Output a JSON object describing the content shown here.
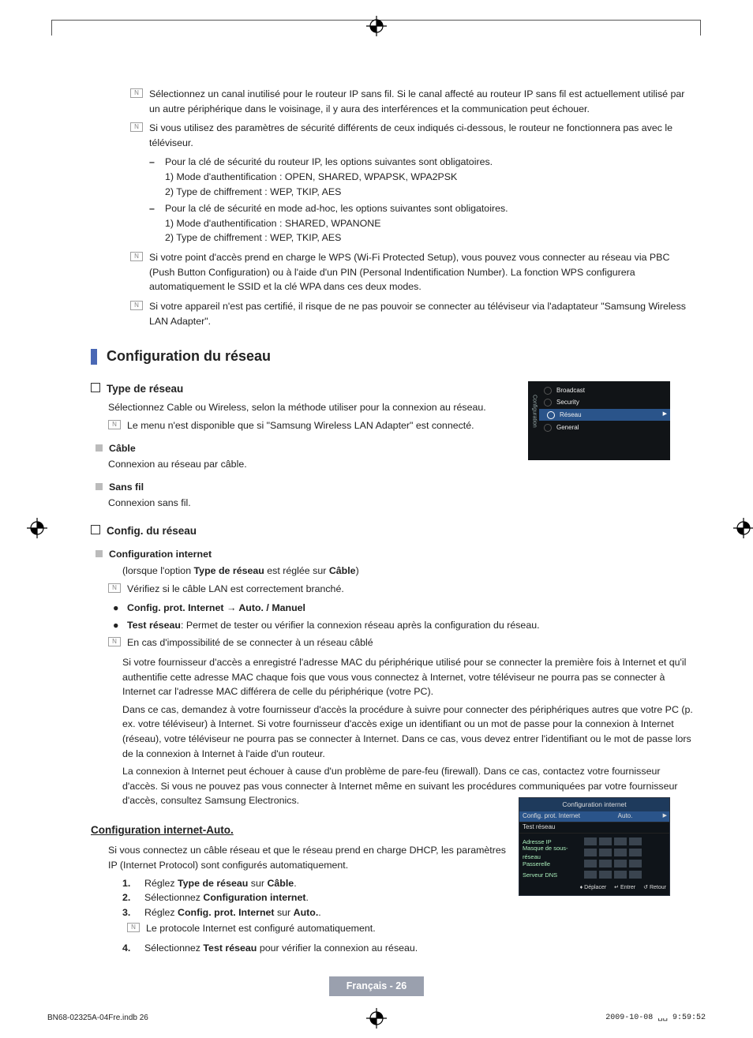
{
  "notes": {
    "n1": "Sélectionnez un canal inutilisé pour le routeur IP sans fil. Si le canal affecté au routeur IP sans fil est actuellement utilisé par un autre périphérique dans le voisinage, il y aura des interférences et la communication peut échouer.",
    "n2": "Si vous utilisez des paramètres de sécurité différents de ceux indiqués ci-dessous, le routeur ne fonctionnera pas avec le téléviseur.",
    "n2a": "Pour la clé de sécurité du routeur IP, les options suivantes sont obligatoires.",
    "n2a1": "1) Mode d'authentification : OPEN, SHARED, WPAPSK, WPA2PSK",
    "n2a2": "2) Type de chiffrement : WEP, TKIP, AES",
    "n2b": "Pour la clé de sécurité en mode ad-hoc, les options suivantes sont obligatoires.",
    "n2b1": "1) Mode d'authentification : SHARED, WPANONE",
    "n2b2": "2) Type de chiffrement : WEP, TKIP, AES",
    "n3": "Si votre point d'accès prend en charge le WPS (Wi-Fi Protected Setup), vous pouvez vous connecter au réseau via PBC (Push Button Configuration) ou à l'aide d'un PIN (Personal Indentification Number). La fonction WPS configurera automatiquement le SSID et la clé WPA dans ces deux modes.",
    "n4": "Si votre appareil n'est pas certifié, il risque de ne pas pouvoir se connecter au téléviseur via l'adaptateur \"Samsung Wireless LAN Adapter\"."
  },
  "section_title": "Configuration du réseau",
  "typeReseau": {
    "heading": "Type de réseau",
    "intro": "Sélectionnez Cable ou Wireless, selon la méthode utiliser pour la connexion au réseau.",
    "note": "Le menu n'est disponible que si \"Samsung Wireless LAN Adapter\" est connecté.",
    "cable_h": "Câble",
    "cable_b": "Connexion au réseau par câble.",
    "sans_h": "Sans fil",
    "sans_b": "Connexion sans fil."
  },
  "configReseau": {
    "heading": "Config. du réseau",
    "ci_h": "Configuration internet",
    "ci_pre": "(lorsque l'option ",
    "ci_b1": "Type de réseau",
    "ci_mid": " est réglée sur ",
    "ci_b2": "Câble",
    "ci_post": ")",
    "ci_note": "Vérifiez si le câble LAN est correctement branché.",
    "bul1_b": "Config. prot. Internet",
    "bul1_t": " → Auto. / Manuel",
    "bul2_b": "Test réseau",
    "bul2_t": ": Permet de tester ou vérifier la connexion réseau après la configuration du réseau.",
    "cannot": "En cas d'impossibilité de se connecter à un réseau câblé",
    "p1": "Si votre fournisseur d'accès a enregistré l'adresse MAC du périphérique utilisé pour se connecter la première fois à Internet et qu'il authentifie cette adresse MAC chaque fois que vous vous connectez à Internet, votre téléviseur ne pourra pas se connecter à Internet car l'adresse MAC différera de celle du périphérique (votre PC).",
    "p2": "Dans ce cas, demandez à votre fournisseur d'accès la procédure à suivre pour connecter des périphériques autres que votre PC (p. ex. votre téléviseur) à Internet. Si votre fournisseur d'accès exige un identifiant ou un mot de passe pour la connexion à Internet (réseau), votre téléviseur ne pourra pas se connecter à Internet. Dans ce cas, vous devez entrer l'identifiant ou le mot de passe lors de la connexion à Internet à l'aide d'un routeur.",
    "p3": "La connexion à Internet peut échouer à cause d'un problème de pare-feu (firewall). Dans ce cas, contactez votre fournisseur d'accès. Si vous ne pouvez pas vous connecter à Internet même en suivant les procédures communiquées par votre fournisseur d'accès, consultez Samsung Electronics."
  },
  "autoSection": {
    "title": "Configuration internet-Auto.",
    "intro": "Si vous connectez un câble réseau et que le réseau prend en charge DHCP, les paramètres IP (Internet Protocol) sont configurés automatiquement.",
    "s1_pre": "Réglez ",
    "s1_b": "Type de réseau",
    "s1_mid": " sur ",
    "s1_b2": "Câble",
    "s1_post": ".",
    "s2_pre": "Sélectionnez ",
    "s2_b": "Configuration internet",
    "s2_post": ".",
    "s3_pre": "Réglez ",
    "s3_b": "Config. prot. Internet",
    "s3_mid": " sur ",
    "s3_b2": "Auto.",
    "s3_post": ".",
    "s3_note": "Le protocole Internet est configuré automatiquement.",
    "s4_pre": "Sélectionnez ",
    "s4_b": "Test réseau",
    "s4_post": " pour vérifier la connexion au réseau."
  },
  "notebox": "N",
  "fig1": {
    "side": "Configuration",
    "r1": "Broadcast",
    "r2": "Security",
    "r3": "Réseau",
    "r4": "General"
  },
  "fig2": {
    "title": "Configuration internet",
    "row1l": "Config. prot. Internet",
    "row1v": "Auto.",
    "row2l": "Test réseau",
    "g1": "Adresse IP",
    "g2": "Masque de sous-réseau",
    "g3": "Passerelle",
    "g4": "Serveur DNS",
    "f1": "Déplacer",
    "f2": "Entrer",
    "f3": "Retour"
  },
  "footer": {
    "lang": "Français - 26",
    "left": "BN68-02325A-04Fre.indb   26",
    "right": "2009-10-08   ␣␣ 9:59:52"
  }
}
